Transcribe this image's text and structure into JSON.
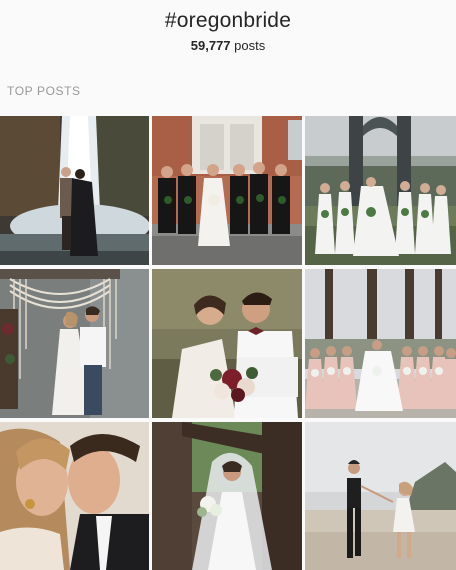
{
  "hashtag": {
    "title": "#oregonbride",
    "count": "59,777",
    "count_suffix": "posts"
  },
  "section": {
    "label": "TOP POSTS"
  },
  "posts": [
    {
      "subject": "couple-at-waterfall"
    },
    {
      "subject": "bride-with-bridesmaids-black-dresses"
    },
    {
      "subject": "bridal-party-under-bridge"
    },
    {
      "subject": "couple-macrame-backdrop"
    },
    {
      "subject": "couple-close-portrait"
    },
    {
      "subject": "bridal-party-pink-dresses-forest"
    },
    {
      "subject": "couple-kiss-closeup"
    },
    {
      "subject": "bride-with-veil-bouquet"
    },
    {
      "subject": "couple-holding-hands-beach"
    }
  ]
}
